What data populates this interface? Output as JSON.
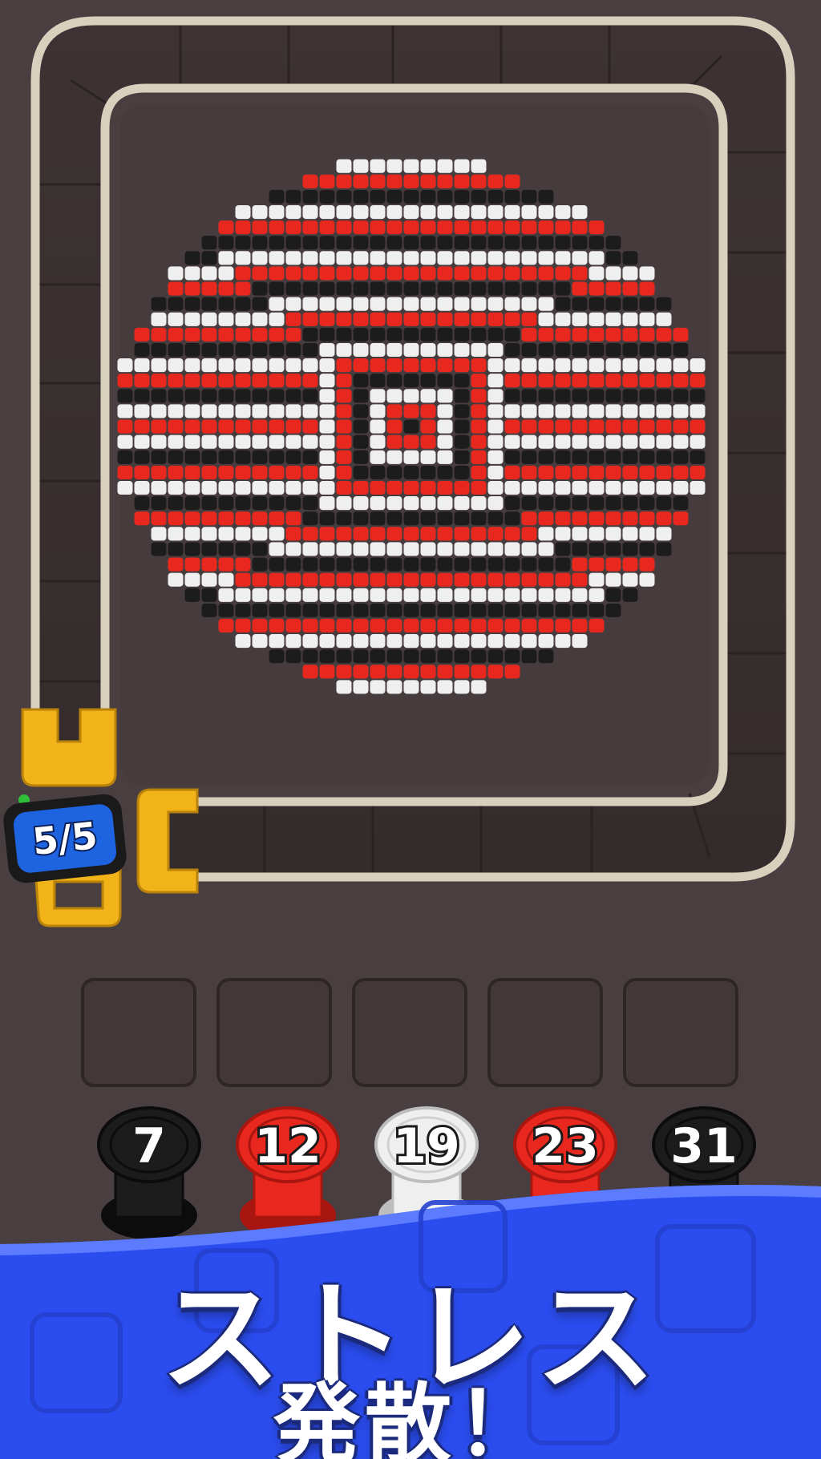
{
  "colors": {
    "background": "#4a3f40",
    "red": "#e8281f",
    "white": "#efefef",
    "black": "#1c1c1c",
    "belt": "#d9d2bf",
    "clip_yellow": "#f2b318",
    "counter_blue": "#1e63e0",
    "banner_blue": "#2b4df0"
  },
  "pattern": {
    "description_colors_order": [
      "red",
      "white",
      "black"
    ],
    "shape": "diamond-disc"
  },
  "counter": {
    "value": "5/5"
  },
  "slots": {
    "count": 5
  },
  "spools": [
    {
      "number": "7",
      "color": "black"
    },
    {
      "number": "12",
      "color": "red"
    },
    {
      "number": "19",
      "color": "white"
    },
    {
      "number": "23",
      "color": "red"
    },
    {
      "number": "31",
      "color": "black"
    }
  ],
  "promo": {
    "line1": "ストレス",
    "line2": "発散！"
  }
}
